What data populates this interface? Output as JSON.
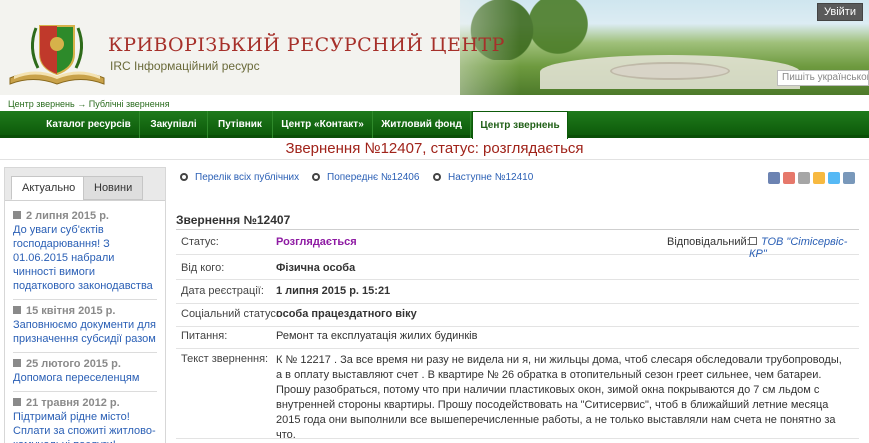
{
  "header": {
    "title": "КРИВОРІЗЬКИЙ РЕСУРСНИЙ ЦЕНТР",
    "subtitle": "IRC Інформаційний ресурс",
    "login_label": "Увійти",
    "lang_label": "Пишіть українською"
  },
  "breadcrumb": [
    "Центр звернень",
    "Публічні звернення"
  ],
  "breadcrumb_sep": "→",
  "nav": {
    "items": [
      "Каталог ресурсів",
      "Закупівлі",
      "Путівник",
      "Центр «Контакт»",
      "Житловий фонд",
      "Центр звернень"
    ]
  },
  "page_title": "Звернення №12407, статус: розглядається",
  "sidebar": {
    "tabs": [
      "Актуально",
      "Новини"
    ],
    "news": [
      {
        "date": "2 липня 2015 р.",
        "text": "До уваги суб'єктів господарювання! З 01.06.2015 набрали чинності вимоги податкового законодавства"
      },
      {
        "date": "15 квітня 2015 р.",
        "text": "Заповнюємо документи для призначення субсидії разом"
      },
      {
        "date": "25 лютого 2015 р.",
        "text": "Допомога переселенцям"
      },
      {
        "date": "21 травня 2012 р.",
        "text": "Підтримай рідне місто! Сплати за спожиті житлово-комунальні послуги!"
      }
    ]
  },
  "links": {
    "list": "Перелік всіх публічних",
    "prev": "Попереднє №12406",
    "next": "Наступне №12410"
  },
  "appeal": {
    "heading": "Звернення №12407",
    "status_label": "Статус:",
    "status_value": "Розглядається",
    "responsible_label": "Відповідальний:",
    "responsible_value": "ТОВ \"Сітісервіс-КР\"",
    "from_label": "Від кого:",
    "from_value": "Фізична особа",
    "date_label": "Дата реєстрації:",
    "date_value": "1 липня 2015 р. 15:21",
    "social_label": "Соціальний статус:",
    "social_value": "особа працездатного віку",
    "question_label": "Питання:",
    "question_value": "Ремонт та експлуатація жилих будинків",
    "text_label": "Текст звернення:",
    "text_value": "К № 12217 . За все время ни разу не видела ни я, ни жильцы дома, чтоб слесаря обследовали трубопроводы, а в оплату выставляют счет . В квартире № 26 обратка в отопительный сезон греет сильнее, чем батареи. Прошу разобраться, потому что при наличии пластиковых окон, зимой окна покрываются до 7 см льдом с внутренней стороны квартиры. Прошу посодействовать на \"Ситисервис\", чтоб в ближайший летние месяца 2015 года они выполнили все вышеперечисленные работы, а не только выставляли нам счета не понятно за что."
  },
  "colors": {
    "brand_green": "#1f7a1c",
    "title_red": "#a0231a",
    "status_purple": "#8e1aa3",
    "link_blue": "#2a5fb5"
  }
}
